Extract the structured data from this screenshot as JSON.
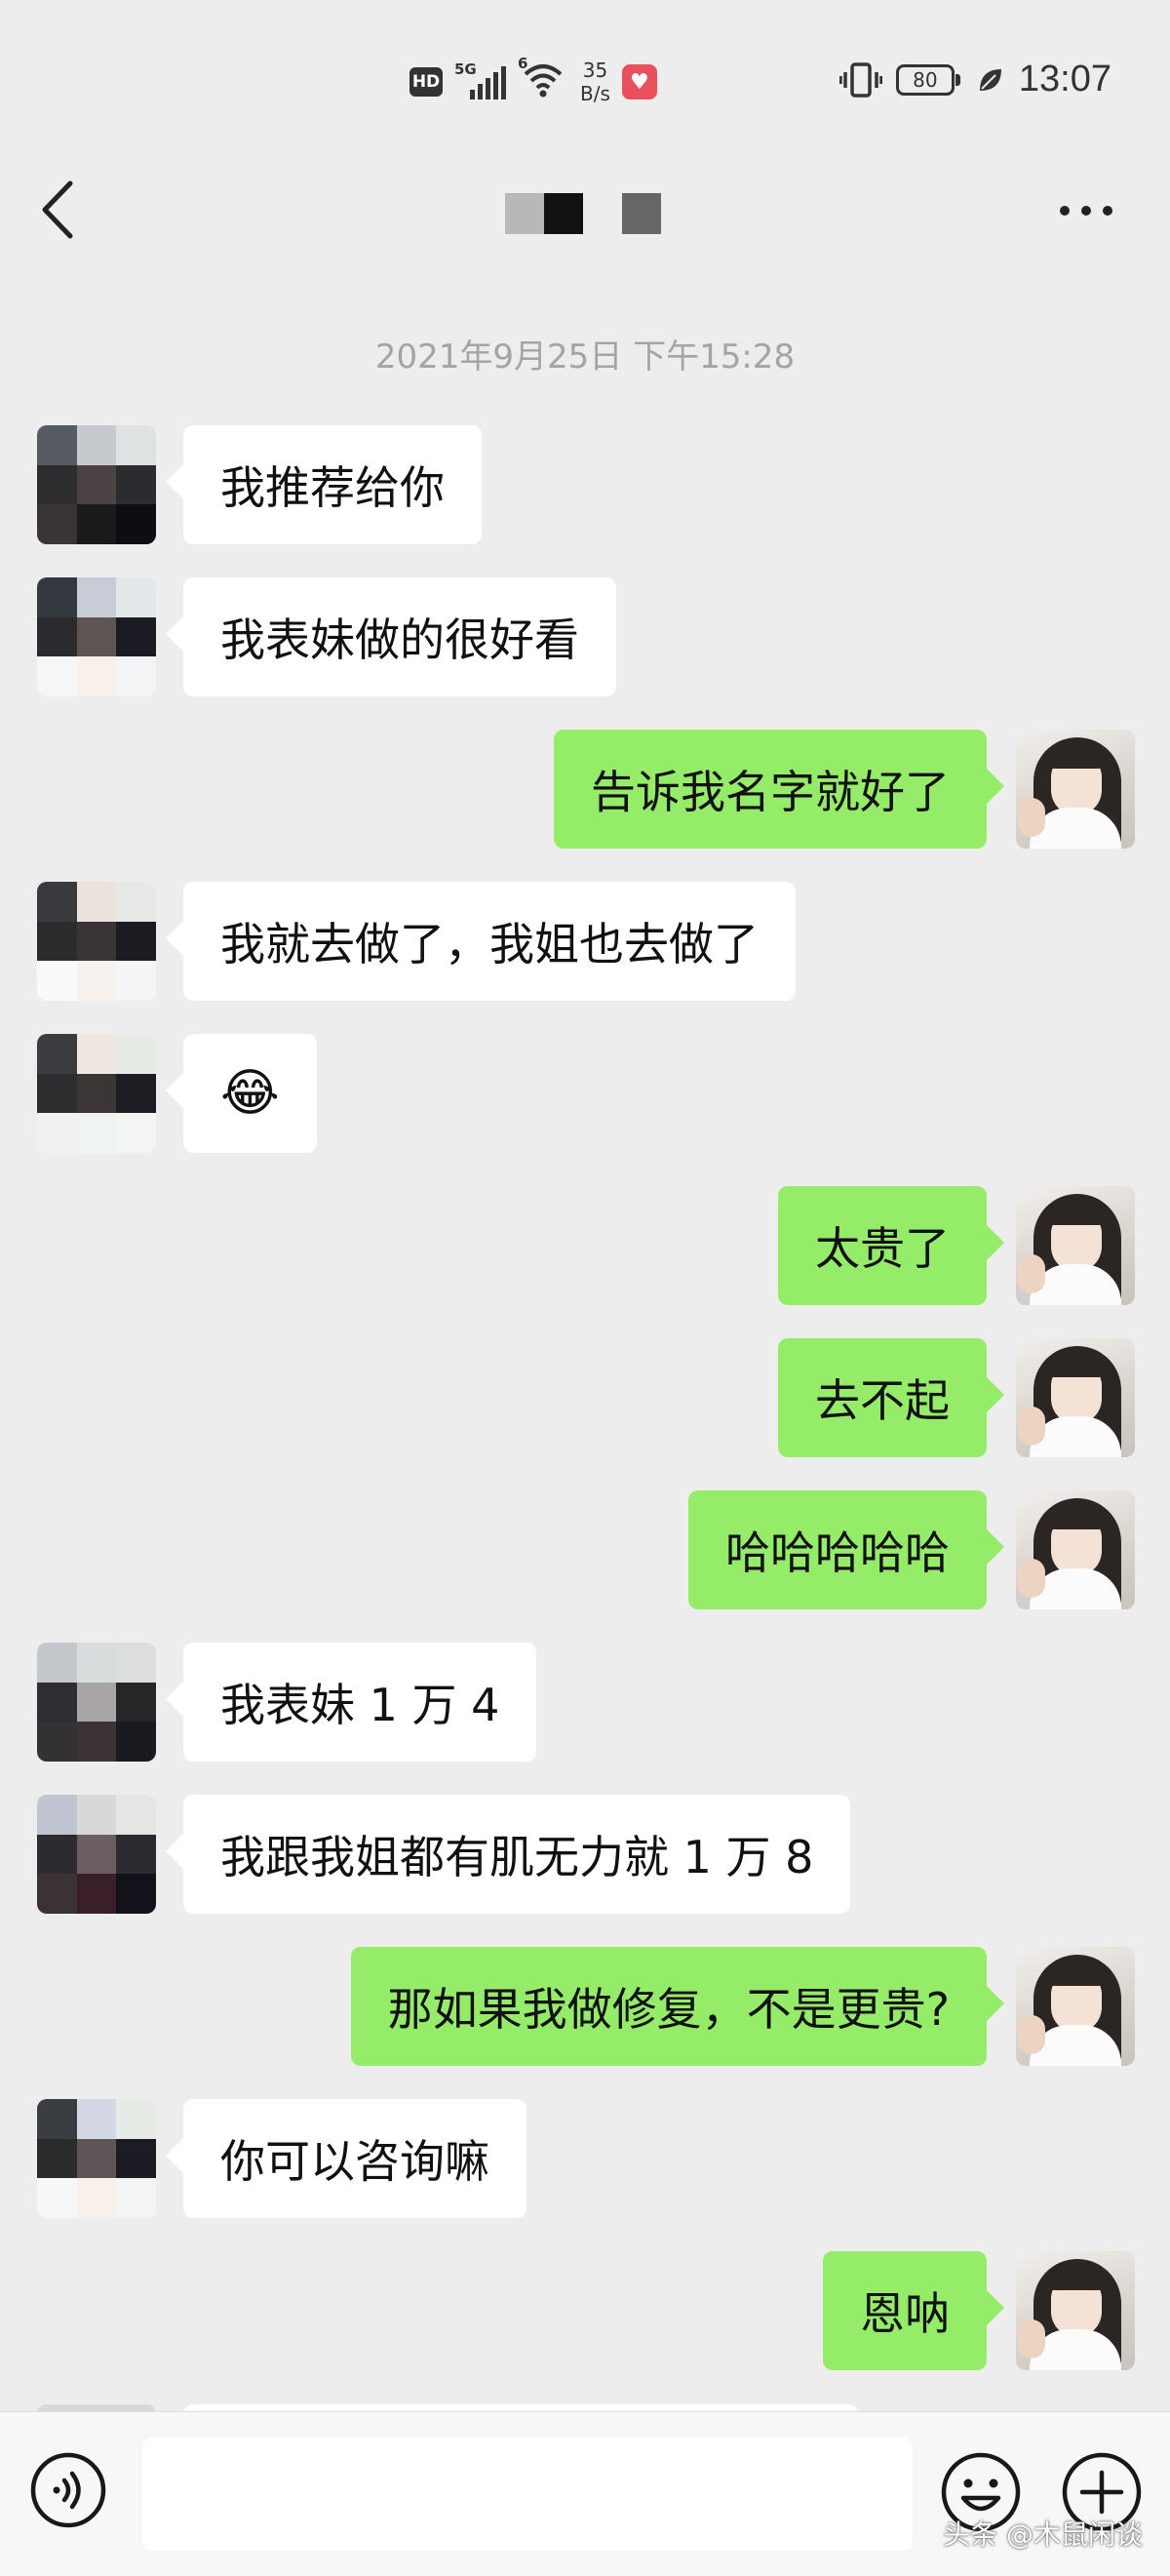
{
  "status_bar": {
    "hd": "HD",
    "signal1": "5G",
    "signal2": "6",
    "speed_value": "35",
    "speed_unit": "B/s",
    "battery": "80",
    "time": "13:07"
  },
  "header": {
    "back_icon": "chevron-left-icon",
    "more_icon": "more-horizontal-icon",
    "title": "obscured-pixelated-name"
  },
  "timestamp": "2021年9月25日 下午15:28",
  "messages": [
    {
      "side": "in",
      "text": "我推荐给你"
    },
    {
      "side": "in",
      "text": "我表妹做的很好看"
    },
    {
      "side": "out",
      "text": "告诉我名字就好了"
    },
    {
      "side": "in",
      "text": "我就去做了，我姐也去做了"
    },
    {
      "side": "in",
      "text": "😂"
    },
    {
      "side": "out",
      "text": "太贵了"
    },
    {
      "side": "out",
      "text": "去不起"
    },
    {
      "side": "out",
      "text": "哈哈哈哈哈"
    },
    {
      "side": "in",
      "text": "我表妹 1 万 4"
    },
    {
      "side": "in",
      "text": "我跟我姐都有肌无力就 1 万 8"
    },
    {
      "side": "out",
      "text": "那如果我做修复，不是更贵?"
    },
    {
      "side": "in",
      "text": " 你可以咨询嘛"
    },
    {
      "side": "out",
      "text": "恩呐"
    }
  ],
  "input_bar": {
    "voice_icon": "voice-icon",
    "input_value": "",
    "emoji_icon": "emoji-icon",
    "plus_icon": "plus-circle-icon"
  },
  "watermark": "头条 @木鼠闲谈",
  "colors": {
    "background": "#ededed",
    "outgoing_bubble": "#95ec69",
    "incoming_bubble": "#ffffff",
    "timestamp": "#a4a4a4"
  }
}
